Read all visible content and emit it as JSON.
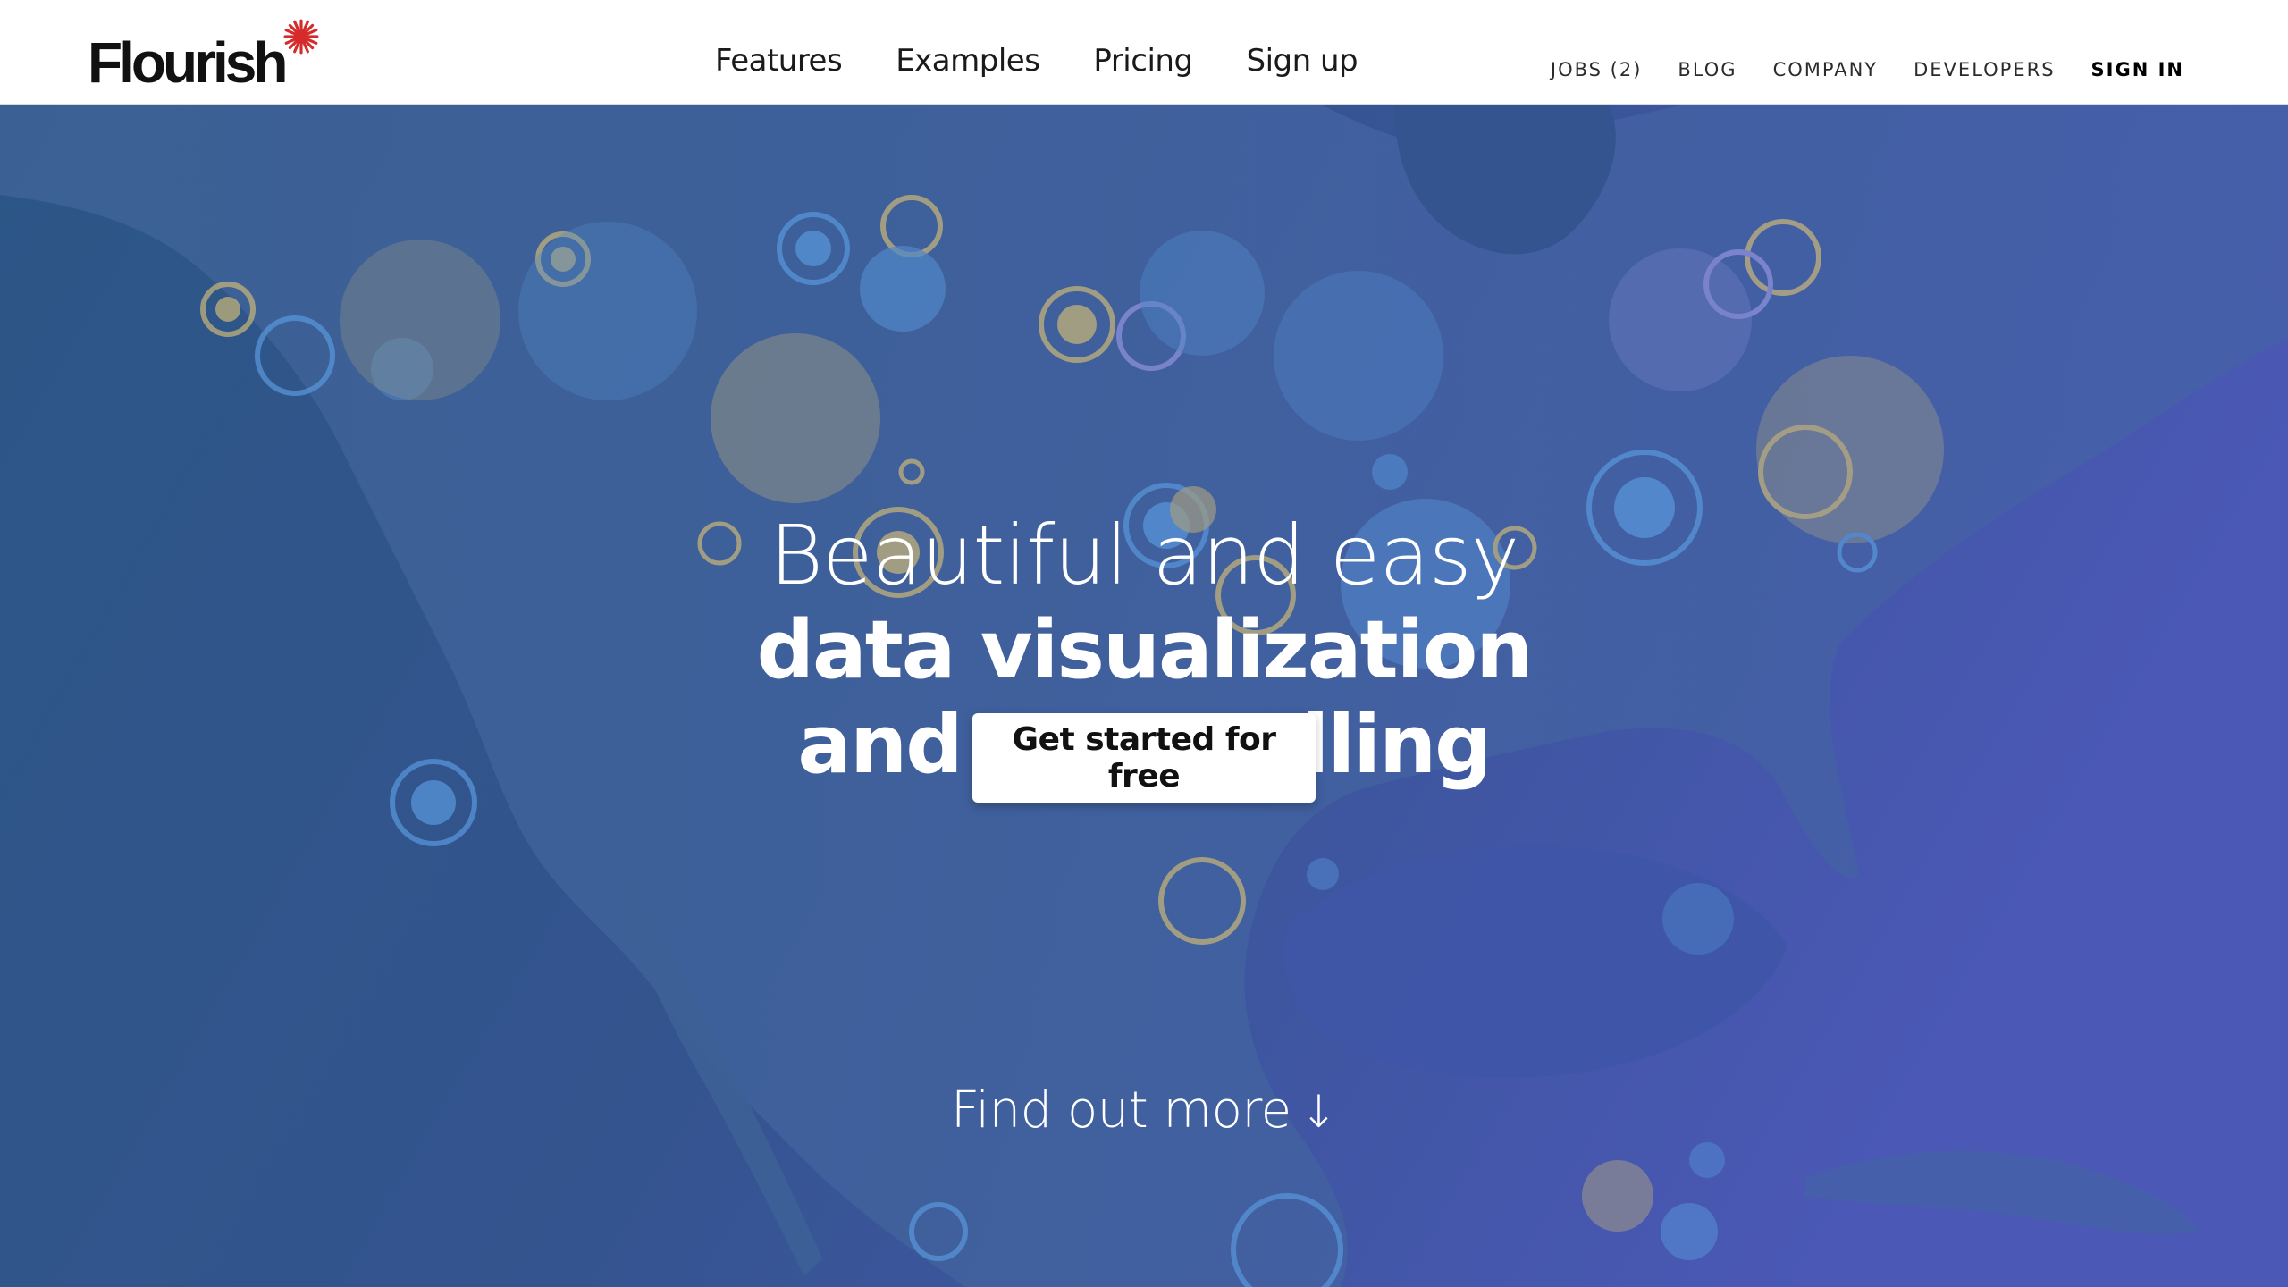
{
  "header": {
    "logo_text": "Flourish",
    "logo_accent": "#d62b2b",
    "main_nav": [
      {
        "label": "Features"
      },
      {
        "label": "Examples"
      },
      {
        "label": "Pricing"
      },
      {
        "label": "Sign up"
      }
    ],
    "secondary_nav": [
      {
        "label": "JOBS (2)"
      },
      {
        "label": "BLOG"
      },
      {
        "label": "COMPANY"
      },
      {
        "label": "DEVELOPERS"
      },
      {
        "label": "SIGN IN"
      }
    ]
  },
  "hero": {
    "line1": "Beautiful and easy",
    "line2": "data visualization",
    "line3": "and storytelling",
    "cta_label": "Get started for free",
    "find_more_label": "Find out more",
    "find_more_icon": "arrow-down-icon",
    "colors": {
      "background_left": "#2e5688",
      "background_right": "#4a58b4",
      "land": "#3c5f96",
      "bubble_yellow": "#b9a96a",
      "bubble_blue": "#4f8ad0"
    }
  }
}
